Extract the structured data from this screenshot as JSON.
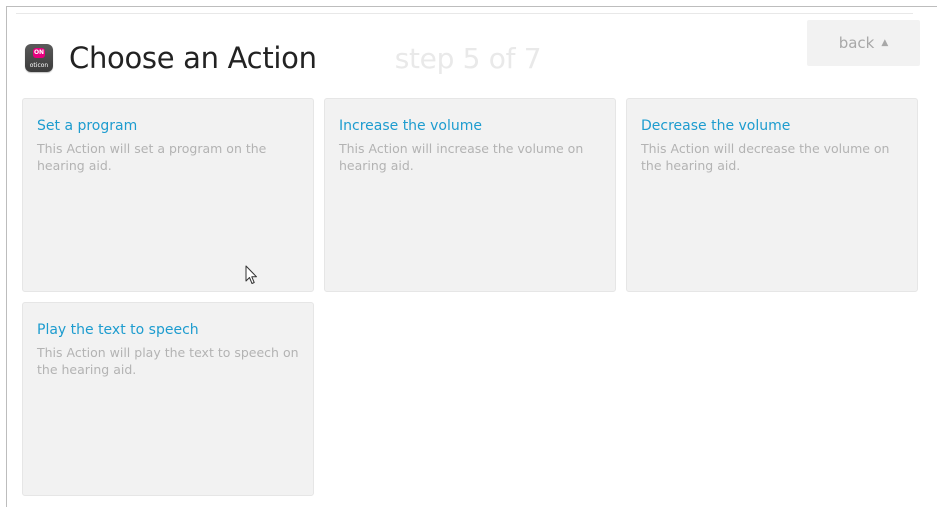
{
  "header": {
    "title": "Choose an Action",
    "step": "step 5 of 7",
    "app_icon": {
      "name": "oticon-app-icon",
      "badge_text": "ON",
      "wordmark": "oticon",
      "badge_color": "#e6007e"
    },
    "back_label": "back",
    "back_icon": "caret-up-icon"
  },
  "actions": [
    {
      "title": "Set a program",
      "description": "This Action will set a program on the hearing aid."
    },
    {
      "title": "Increase the volume",
      "description": "This Action will increase the volume on hearing aid."
    },
    {
      "title": "Decrease the volume",
      "description": "This Action will decrease the volume on the hearing aid."
    },
    {
      "title": "Play the text to speech",
      "description": "This Action will play the text to speech on the hearing aid."
    }
  ],
  "colors": {
    "accent": "#1d9ccf",
    "card_background": "#f2f2f2",
    "title_text": "#222222",
    "muted_text": "#b3b3b3"
  }
}
